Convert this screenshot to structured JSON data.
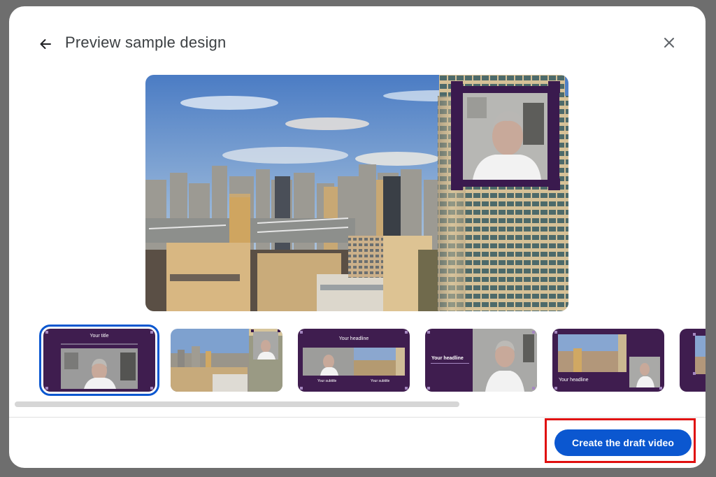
{
  "dialog": {
    "title": "Preview sample design",
    "back_icon": "arrow-left-icon",
    "close_icon": "close-icon"
  },
  "thumbnails": [
    {
      "layout": "title-over-speaker",
      "title_text": "Your title",
      "selected": true
    },
    {
      "layout": "city-with-speaker-inset",
      "selected": false
    },
    {
      "layout": "headline-split",
      "title_text": "Your headline",
      "subtitle_left": "Your subtitle",
      "subtitle_right": "Your subtitle",
      "selected": false
    },
    {
      "layout": "headline-left-speaker-right",
      "title_text": "Your headline",
      "selected": false
    },
    {
      "layout": "city-speaker-headline",
      "title_text": "Your headline",
      "selected": false
    },
    {
      "layout": "partial",
      "selected": false
    }
  ],
  "footer": {
    "create_button_label": "Create the draft video"
  },
  "colors": {
    "accent": "#0b57d0",
    "brand_purple": "#3f1d4f",
    "highlight": "#e01010"
  }
}
